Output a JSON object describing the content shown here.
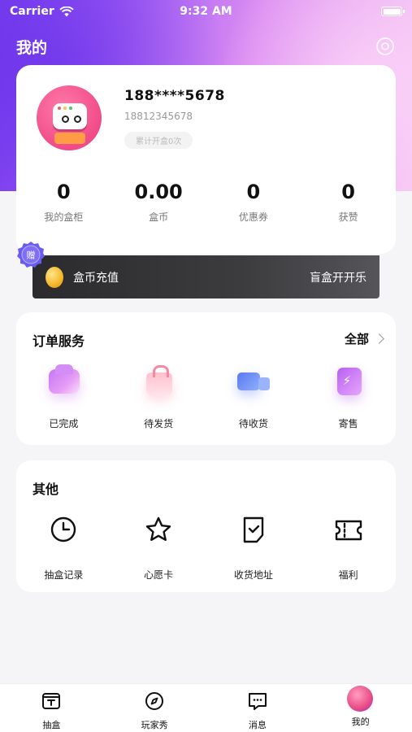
{
  "status_bar": {
    "carrier": "Carrier",
    "time": "9:32 AM"
  },
  "header": {
    "title": "我的"
  },
  "profile": {
    "phone_masked": "188****5678",
    "phone_full": "18812345678",
    "open_count": "累计开盒0次",
    "stats": [
      {
        "value": "0",
        "label": "我的盒柜"
      },
      {
        "value": "0.00",
        "label": "盒币"
      },
      {
        "value": "0",
        "label": "优惠券"
      },
      {
        "value": "0",
        "label": "获赞"
      }
    ]
  },
  "coin_bar": {
    "label": "盒币充值",
    "slogan": "盲盒开开乐",
    "badge": "赠"
  },
  "orders": {
    "title": "订单服务",
    "more": "全部",
    "items": [
      {
        "label": "已完成",
        "icon": "completed-icon"
      },
      {
        "label": "待发货",
        "icon": "bag-icon"
      },
      {
        "label": "待收货",
        "icon": "truck-icon"
      },
      {
        "label": "寄售",
        "icon": "consign-icon"
      }
    ]
  },
  "other": {
    "title": "其他",
    "items": [
      {
        "label": "抽盒记录",
        "icon": "clock-icon"
      },
      {
        "label": "心愿卡",
        "icon": "star-icon"
      },
      {
        "label": "收货地址",
        "icon": "address-icon"
      },
      {
        "label": "福利",
        "icon": "ticket-icon"
      }
    ]
  },
  "tabbar": {
    "items": [
      {
        "label": "抽盒",
        "icon": "box-icon"
      },
      {
        "label": "玩家秀",
        "icon": "compass-icon"
      },
      {
        "label": "消息",
        "icon": "message-icon"
      },
      {
        "label": "我的",
        "icon": "avatar-icon"
      }
    ]
  },
  "colors": {
    "accent": "#9b4ff2",
    "coin_bar": "#2f2f31"
  }
}
